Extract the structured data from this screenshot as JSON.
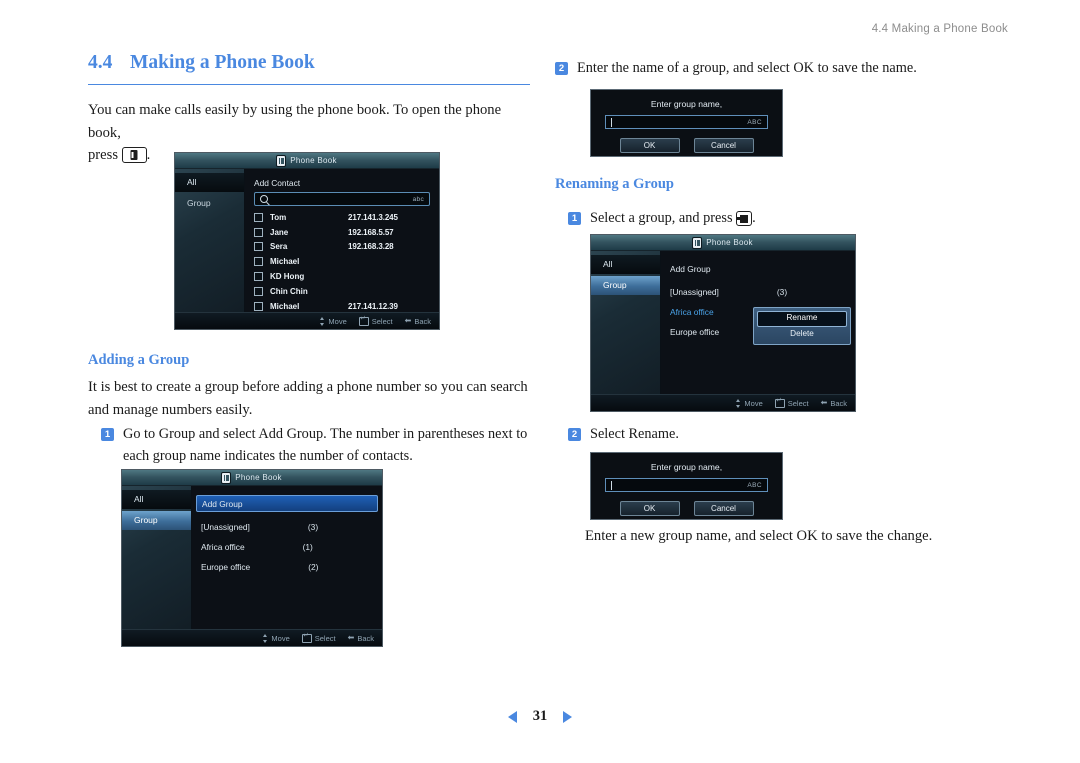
{
  "header": {
    "running_title": "4.4 Making a Phone Book"
  },
  "section": {
    "number": "4.4",
    "title": "Making a Phone Book",
    "intro_part1": "You can make calls easily by using the phone book. To open the phone book,",
    "intro_part2": "press",
    "intro_part3": "."
  },
  "adding_group": {
    "heading": "Adding a Group",
    "paragraph": "It is best to create a group before adding a phone number so you can search and manage numbers easily.",
    "step1_num": "1",
    "step1_text": "Go to Group and select Add Group.  The number in parentheses next to each group name indicates the number of contacts."
  },
  "renaming_group": {
    "heading": "Renaming a Group",
    "step1_num": "1",
    "step1_text_a": "Select a group, and press",
    "step1_text_b": ".",
    "step2_num": "2",
    "step2_text": "Select Rename.",
    "closing_text": "Enter a new group name, and select OK to save the change."
  },
  "right_col": {
    "step2_num": "2",
    "step2_text": "Enter the name of a group, and select OK to save the name."
  },
  "osd_contacts": {
    "title": "Phone Book",
    "title_icon": "phonebook-icon",
    "sidebar": [
      {
        "label": "All",
        "state": "selected-dark"
      },
      {
        "label": "Group",
        "state": "normal"
      }
    ],
    "add_contact_label": "Add Contact",
    "search": {
      "icon": "search-icon",
      "value": "",
      "ime_mode": "abc"
    },
    "contacts": [
      {
        "name": "Tom",
        "ip": "217.141.3.245",
        "checked": false
      },
      {
        "name": "Jane",
        "ip": "192.168.5.57",
        "checked": false
      },
      {
        "name": "Sera",
        "ip": "192.168.3.28",
        "checked": false
      },
      {
        "name": "Michael",
        "ip": "",
        "checked": false
      },
      {
        "name": "KD Hong",
        "ip": "",
        "checked": false
      },
      {
        "name": "Chin Chin",
        "ip": "",
        "checked": false
      },
      {
        "name": "Michael",
        "ip": "217.141.12.39",
        "checked": false
      }
    ],
    "footer": [
      {
        "icon": "updown-arrows-icon",
        "label": "Move"
      },
      {
        "icon": "enter-key-icon",
        "label": "Select"
      },
      {
        "icon": "back-arrow-icon",
        "label": "Back"
      }
    ]
  },
  "osd_groups": {
    "title": "Phone Book",
    "title_icon": "phonebook-icon",
    "sidebar": [
      {
        "label": "All",
        "state": "normal"
      },
      {
        "label": "Group",
        "state": "selected-blue"
      }
    ],
    "add_group_label": "Add Group",
    "rows": [
      {
        "label": "[Unassigned]",
        "count": "(3)"
      },
      {
        "label": "Africa office",
        "count": "(1)"
      },
      {
        "label": "Europe office",
        "count": "(2)"
      }
    ],
    "footer": [
      {
        "icon": "updown-arrows-icon",
        "label": "Move"
      },
      {
        "icon": "enter-key-icon",
        "label": "Select"
      },
      {
        "icon": "back-arrow-icon",
        "label": "Back"
      }
    ]
  },
  "osd_rename": {
    "title": "Phone Book",
    "title_icon": "phonebook-icon",
    "sidebar": [
      {
        "label": "All",
        "state": "normal"
      },
      {
        "label": "Group",
        "state": "selected-blue"
      }
    ],
    "add_group_label": "Add Group",
    "rows": [
      {
        "label": "[Unassigned]",
        "count": "(3)"
      },
      {
        "label": "Africa office",
        "count": ""
      },
      {
        "label": "Europe office",
        "count": ""
      }
    ],
    "context_menu": {
      "items": [
        {
          "label": "Rename",
          "selected": true
        },
        {
          "label": "Delete",
          "selected": false
        }
      ]
    },
    "footer": [
      {
        "icon": "updown-arrows-icon",
        "label": "Move"
      },
      {
        "icon": "enter-key-icon",
        "label": "Select"
      },
      {
        "icon": "back-arrow-icon",
        "label": "Back"
      }
    ]
  },
  "dialog_add": {
    "title": "Enter group name,",
    "input_value": "",
    "ime_mode": "ABC",
    "ok_label": "OK",
    "cancel_label": "Cancel"
  },
  "dialog_rename": {
    "title": "Enter group name,",
    "input_value": "",
    "ime_mode": "ABC",
    "ok_label": "OK",
    "cancel_label": "Cancel"
  },
  "footer": {
    "prev_icon": "prev-triangle-icon",
    "page_number": "31",
    "next_icon": "next-triangle-icon"
  },
  "colors": {
    "accent_blue": "#4a88e0",
    "osd_bg": "#0c1016",
    "osd_highlight": "#1f5fb5",
    "osd_group_sel": "#3d6d99",
    "link_blue": "#4aa3e8"
  }
}
